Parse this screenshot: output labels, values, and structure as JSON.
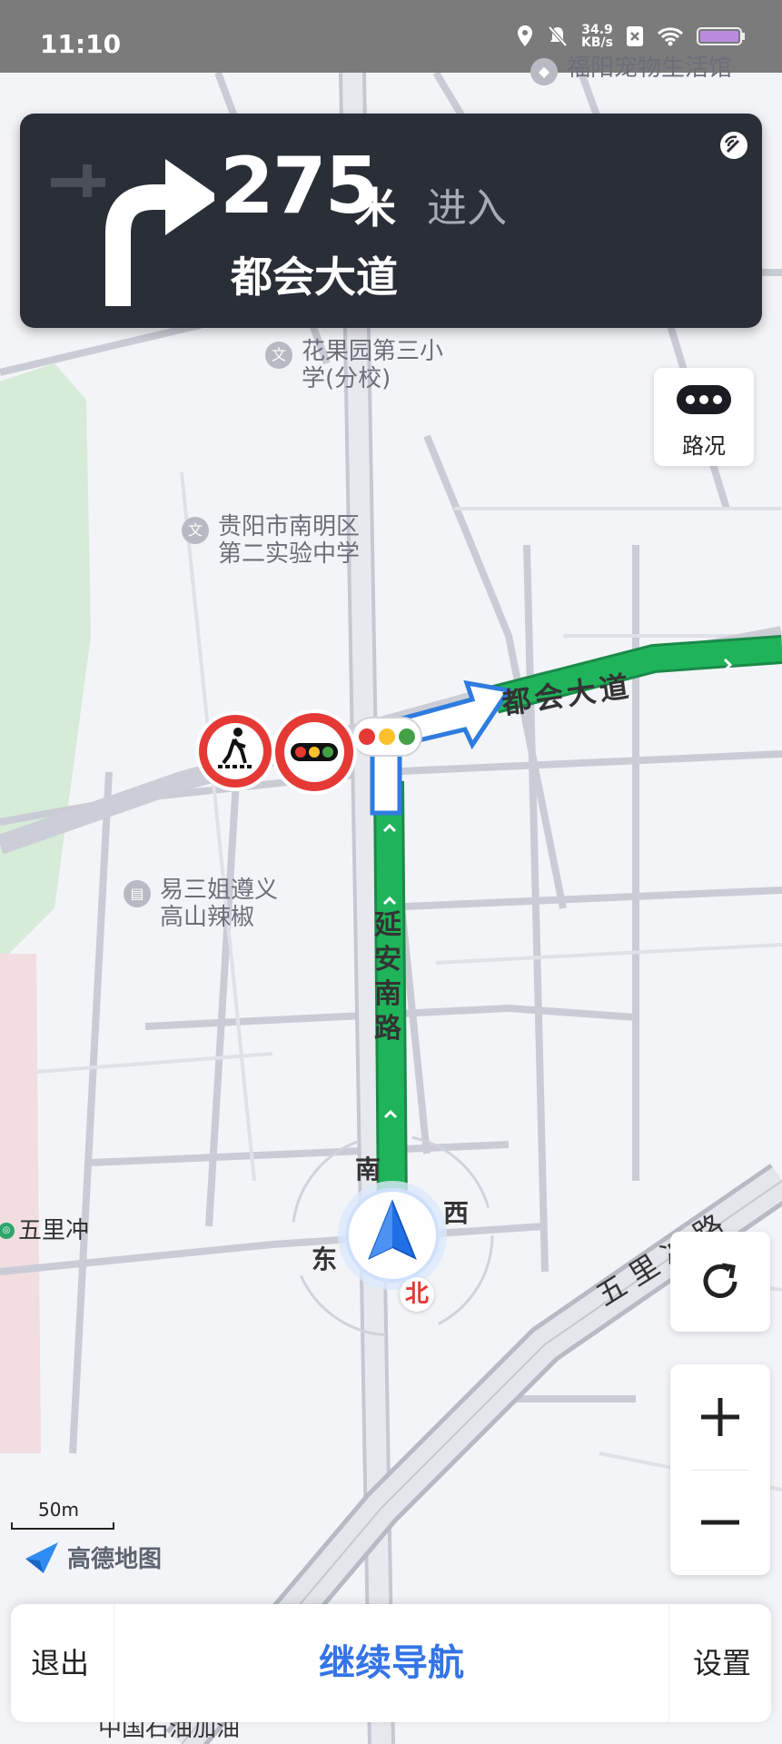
{
  "status_bar": {
    "time": "11:10",
    "net_speed_value": "34.9",
    "net_speed_unit": "KB/s"
  },
  "nav_card": {
    "distance": "275",
    "unit": "米",
    "action": "进入",
    "road": "都会大道"
  },
  "map": {
    "pois": [
      {
        "name_line1": "福阳宠物生活馆",
        "name_line2": ""
      },
      {
        "name_line1": "花果园第三小",
        "name_line2": "学(分校)"
      },
      {
        "name_line1": "贵阳市南明区",
        "name_line2": "第二实验中学"
      },
      {
        "name_line1": "易三姐遵义",
        "name_line2": "高山辣椒"
      },
      {
        "name_line1": "五里冲",
        "name_line2": ""
      },
      {
        "name_line1": "中国石油加油",
        "name_line2": ""
      }
    ],
    "roads": {
      "yanan": "延安南路",
      "duhui": "都会大道",
      "wulichong": "五里冲路"
    },
    "compass": {
      "n": "北",
      "s": "南",
      "e": "东",
      "w": "西"
    },
    "scale_label": "50m",
    "brand": "高德地图"
  },
  "controls": {
    "traffic_label": "路况"
  },
  "bottom_bar": {
    "exit": "退出",
    "continue": "继续导航",
    "settings": "设置"
  },
  "colors": {
    "route_green": "#1fb45a",
    "nav_card_bg": "#2a2e37",
    "accent_blue": "#3474e6"
  }
}
